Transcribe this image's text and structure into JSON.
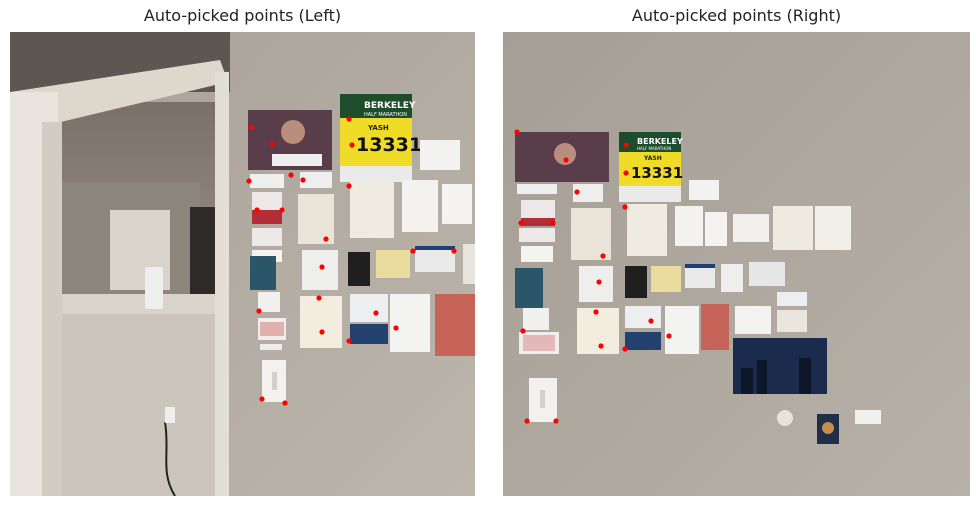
{
  "left_panel": {
    "title": "Auto-picked points (Left)",
    "bib_brand": "BERKELEY",
    "bib_event": "HALF MARATHON",
    "bib_name": "YASH",
    "bib_number": "13331",
    "point_color": "#ff0000"
  },
  "right_panel": {
    "title": "Auto-picked points (Right)",
    "bib_brand": "BERKELEY",
    "bib_event": "HALF MARATHON",
    "bib_name": "YASH",
    "bib_number": "13331",
    "point_color": "#ff0000"
  }
}
